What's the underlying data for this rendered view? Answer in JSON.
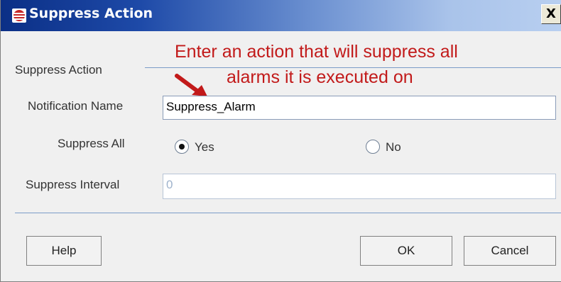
{
  "window": {
    "title": "Suppress Action",
    "close_glyph": "X",
    "app_icon": "bullet-list-icon"
  },
  "section": {
    "label": "Suppress Action"
  },
  "annotation": {
    "line1": "Enter an action that will suppress all",
    "line2": "alarms it is executed on",
    "color": "#c21a1a"
  },
  "form": {
    "notification_name": {
      "label": "Notification Name",
      "value": "Suppress_Alarm"
    },
    "suppress_all": {
      "label": "Suppress All",
      "options": [
        {
          "label": "Yes",
          "selected": true
        },
        {
          "label": "No",
          "selected": false
        }
      ]
    },
    "suppress_interval": {
      "label": "Suppress Interval",
      "value": "0",
      "disabled": true
    }
  },
  "buttons": {
    "help": "Help",
    "ok": "OK",
    "cancel": "Cancel"
  }
}
